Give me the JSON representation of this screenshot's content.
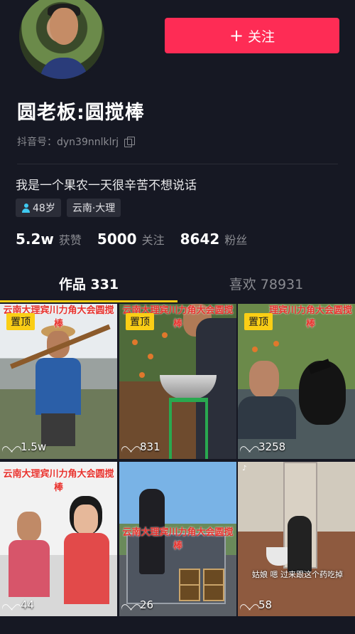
{
  "profile": {
    "nickname": "圆老板:圆搅棒",
    "douyin_id": "抖音号：dyn39nnlklrj",
    "bio": "我是一个果农一天很辛苦不想说话",
    "age_tag": "48岁",
    "location_tag": "云南·大理",
    "follow_button": "关注"
  },
  "stats": [
    {
      "num": "5.2w",
      "label": "获赞"
    },
    {
      "num": "5000",
      "label": "关注"
    },
    {
      "num": "8642",
      "label": "粉丝"
    }
  ],
  "tabs": [
    {
      "label": "作品 331"
    },
    {
      "label": "喜欢 78931"
    }
  ],
  "videos": [
    {
      "pinned": "置顶",
      "caption": "云南大理宾川力角大会圆搅棒",
      "likes": "1.5w"
    },
    {
      "pinned": "置顶",
      "caption": "云南大理宾川力角大会圆搅棒",
      "likes": "831"
    },
    {
      "pinned": "置顶",
      "caption": "理宾川力角大会圆搅棒",
      "likes": "3258"
    },
    {
      "caption": "云南大理宾川力角大会圆搅棒",
      "likes": "44"
    },
    {
      "caption": "云南大理宾川力角大会圆搅棒",
      "likes": "26"
    },
    {
      "caption": "姑娘 嗯 过来跟这个药吃掉",
      "likes": "58"
    }
  ],
  "colors": {
    "accent": "#fe2c55",
    "pin": "#face15",
    "background": "#161823"
  }
}
